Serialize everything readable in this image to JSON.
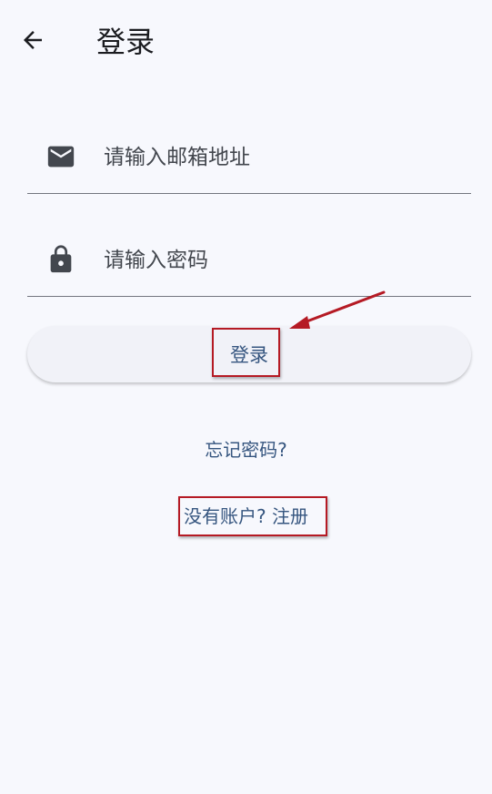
{
  "header": {
    "title": "登录",
    "back_icon": "arrow-left-icon"
  },
  "form": {
    "email": {
      "icon": "mail-icon",
      "placeholder": "请输入邮箱地址",
      "value": ""
    },
    "password": {
      "icon": "lock-icon",
      "placeholder": "请输入密码",
      "value": ""
    },
    "login_label": "登录"
  },
  "links": {
    "forgot_password": "忘记密码?",
    "register": "没有账户? 注册"
  },
  "colors": {
    "background": "#f7f8fd",
    "link": "#35557f",
    "annotation": "#b51a24"
  }
}
